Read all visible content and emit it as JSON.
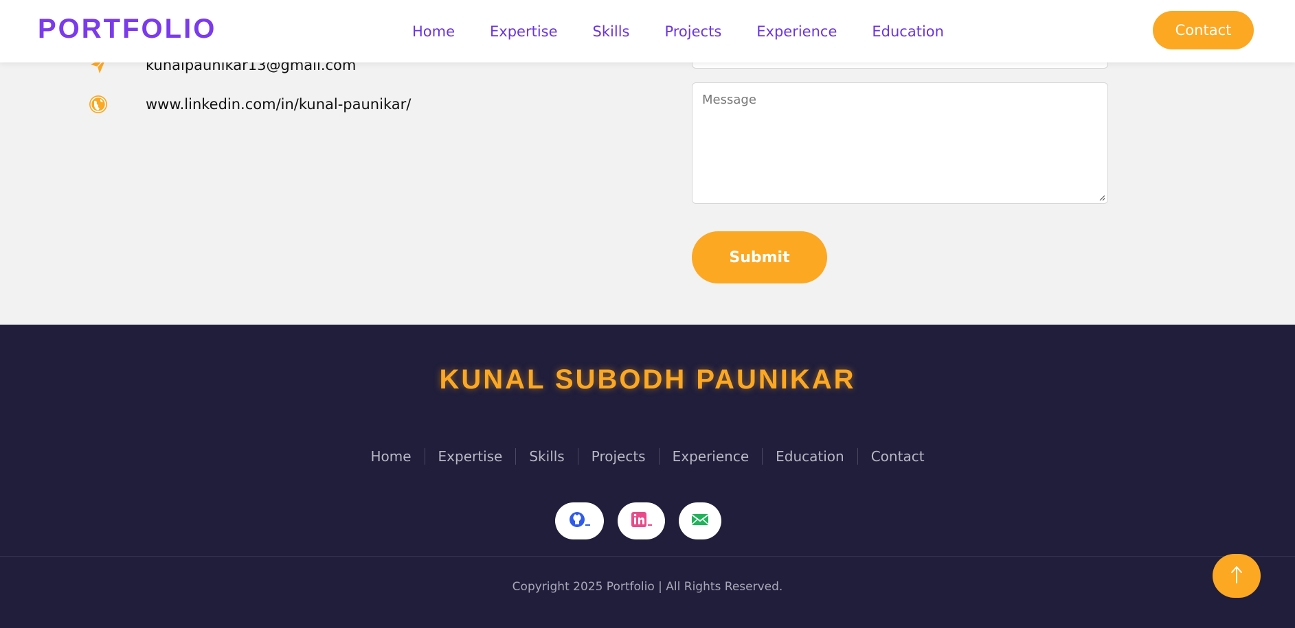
{
  "header": {
    "logo": "PORTFOLIO",
    "nav": [
      "Home",
      "Expertise",
      "Skills",
      "Projects",
      "Experience",
      "Education"
    ],
    "contact_label": "Contact"
  },
  "contact_info": {
    "email": "kunalpaunikar13@gmail.com",
    "linkedin": "www.linkedin.com/in/kunal-paunikar/"
  },
  "form": {
    "message_placeholder": "Message",
    "submit_label": "Submit"
  },
  "footer": {
    "name": "KUNAL SUBODH PAUNIKAR",
    "nav": [
      "Home",
      "Expertise",
      "Skills",
      "Projects",
      "Experience",
      "Education",
      "Contact"
    ],
    "copyright": "Copyright 2025 Portfolio | All Rights Reserved."
  },
  "colors": {
    "accent": "#fca822",
    "brand_purple": "#7b3aec",
    "footer_bg": "#201e3b"
  },
  "icons": {
    "email": "paper-plane-icon",
    "linkedin": "globe-icon",
    "github": "github-icon",
    "linkedin_social": "linkedin-icon",
    "mail_social": "mail-icon",
    "back_to_top": "arrow-up-icon"
  }
}
